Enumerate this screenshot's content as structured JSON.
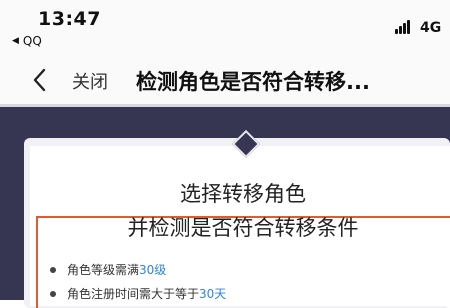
{
  "status_bar": {
    "time": "13:47",
    "back_app": "QQ",
    "network": "4G"
  },
  "nav": {
    "close_label": "关闭",
    "title": "检测角色是否符合转移..."
  },
  "card": {
    "title": "选择转移角色",
    "subtitle": "并检测是否符合转移条件",
    "conditions": [
      {
        "text": "角色等级需满",
        "value": "30级"
      },
      {
        "text": "角色注册时间需大于等于",
        "value": "30天"
      }
    ]
  },
  "colors": {
    "page_bg": "#363652",
    "link": "#2f86d4",
    "highlight_border": "#e05a35"
  }
}
